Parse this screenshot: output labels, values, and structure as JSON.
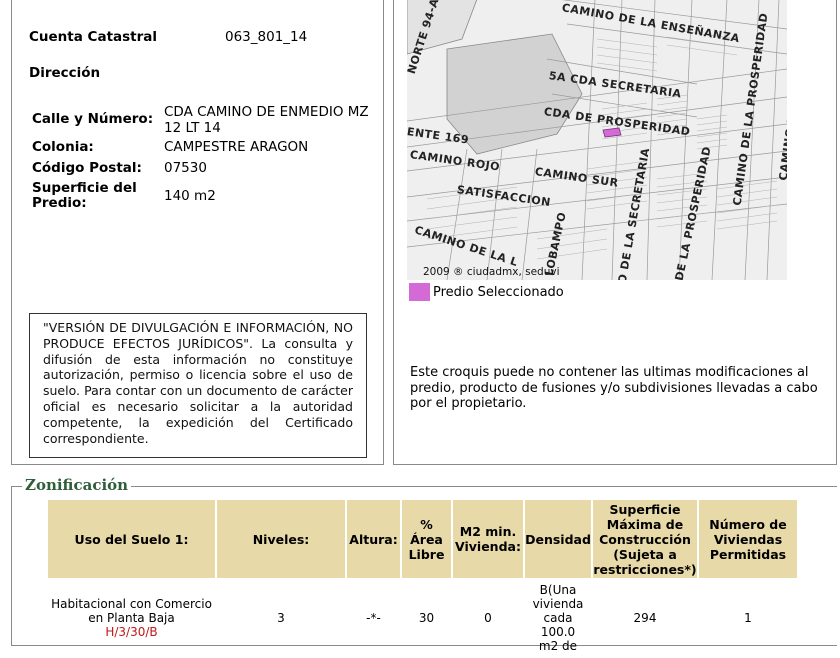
{
  "predio": {
    "cuenta_label": "Cuenta Catastral",
    "cuenta_value": "063_801_14",
    "direccion_label": "Dirección",
    "calle_label": "Calle y Número:",
    "calle_value_1": "CDA CAMINO DE ENMEDIO MZ",
    "calle_value_2": "12 LT 14",
    "colonia_label": "Colonia:",
    "colonia_value": "CAMPESTRE ARAGON",
    "cp_label": "Código Postal:",
    "cp_value": "07530",
    "superficie_label_1": "Superficie del",
    "superficie_label_2": "Predio:",
    "superficie_value": "140 m2"
  },
  "disclaimer": "\"VERSIÓN DE DIVULGACIÓN E INFORMACIÓN, NO PRODUCE EFECTOS JURÍDICOS\". La consulta y difusión de esta información no constituye autorización, permiso o licencia sobre el uso de suelo. Para contar con un documento de carácter oficial es necesario solicitar a la autoridad competente, la expedición del Certificado correspondiente.",
  "map": {
    "streets": {
      "s1": "CAMINO DE LA ENSEÑANZA",
      "s2": "NORTE 94-A",
      "s3": "5A CDA SECRETARIA",
      "s4": "CDA DE PROSPERIDAD",
      "s5": "ENTE 169",
      "s6": "CAMINO ROJO",
      "s7": "CAMINO SUR",
      "s8": "SATISFACCION",
      "s9": "CAMINO DE LA L",
      "s10": "LOBAMPO",
      "s11": "O DE LA SECRETARIA",
      "s12": "DE LA PROSPERIDAD",
      "s13": "CAMINO DE LA PROSPERIDAD",
      "s14": "CAMINO DEL EXITO"
    },
    "copyright": "2009 ® ciudadmx, seduvi",
    "legend_label": "Predio Seleccionado",
    "legend_color": "#d36ad6",
    "note": "Este croquis puede no contener las ultimas modificaciones al predio, producto de fusiones y/o subdivisiones llevadas a cabo por el propietario."
  },
  "zonificacion": {
    "title": "Zonificación",
    "headers": {
      "uso": "Uso del Suelo 1:",
      "niveles": "Niveles:",
      "altura": "Altura:",
      "area_1": "%",
      "area_2": "Área",
      "area_3": "Libre",
      "m2_1": "M2 min.",
      "m2_2": "Vivienda:",
      "densidad": "Densidad",
      "sup_1": "Superficie",
      "sup_2": "Máxima de",
      "sup_3": "Construcción",
      "sup_4": "(Sujeta a",
      "sup_5": "restricciones*)",
      "num_1": "Número de",
      "num_2": "Viviendas",
      "num_3": "Permitidas"
    },
    "row": {
      "uso_1": "Habitacional con Comercio",
      "uso_2": "en Planta Baja",
      "uso_3": "H/3/30/B",
      "niveles": "3",
      "altura": "-*-",
      "area": "30",
      "m2": "0",
      "dens_1": "B(Una",
      "dens_2": "vivienda",
      "dens_3": "cada 100.0",
      "dens_4": "m2 de",
      "superficie": "294",
      "numero": "1"
    },
    "header_bg": "#e8d9a8",
    "title_color": "#2e5e3a"
  }
}
